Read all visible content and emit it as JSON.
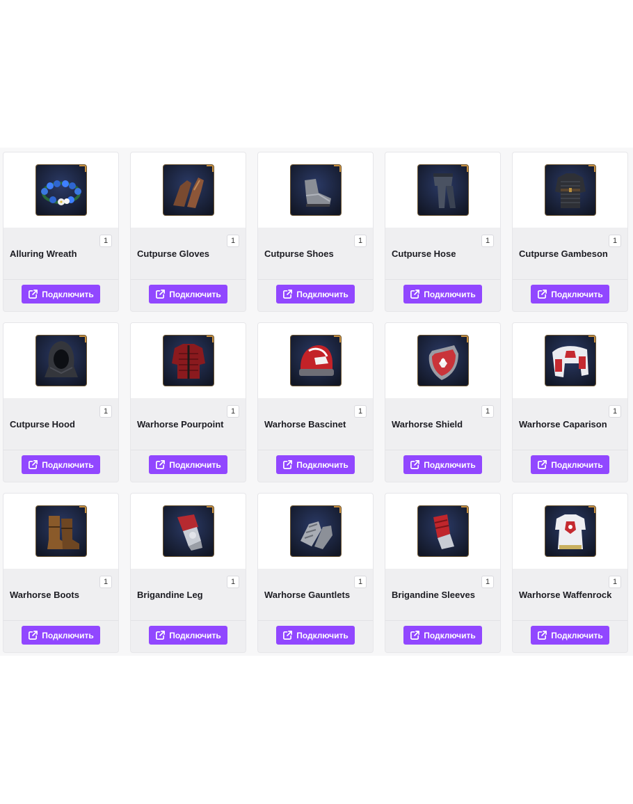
{
  "button_label": "Подключить",
  "accent_color": "#9147ff",
  "items": [
    {
      "name": "Alluring Wreath",
      "count": "1",
      "icon": "flower-wreath-icon"
    },
    {
      "name": "Cutpurse Gloves",
      "count": "1",
      "icon": "gloves-icon"
    },
    {
      "name": "Cutpurse Shoes",
      "count": "1",
      "icon": "shoes-icon"
    },
    {
      "name": "Cutpurse Hose",
      "count": "1",
      "icon": "hose-icon"
    },
    {
      "name": "Cutpurse Gambeson",
      "count": "1",
      "icon": "gambeson-icon"
    },
    {
      "name": "Cutpurse Hood",
      "count": "1",
      "icon": "hood-icon"
    },
    {
      "name": "Warhorse Pourpoint",
      "count": "1",
      "icon": "pourpoint-icon"
    },
    {
      "name": "Warhorse Bascinet",
      "count": "1",
      "icon": "helmet-icon"
    },
    {
      "name": "Warhorse Shield",
      "count": "1",
      "icon": "shield-icon"
    },
    {
      "name": "Warhorse Caparison",
      "count": "1",
      "icon": "caparison-icon"
    },
    {
      "name": "Warhorse Boots",
      "count": "1",
      "icon": "boots-icon"
    },
    {
      "name": "Brigandine Leg",
      "count": "1",
      "icon": "leg-armor-icon"
    },
    {
      "name": "Warhorse Gauntlets",
      "count": "1",
      "icon": "gauntlets-icon"
    },
    {
      "name": "Brigandine Sleeves",
      "count": "1",
      "icon": "sleeves-icon"
    },
    {
      "name": "Warhorse Waffenrock",
      "count": "1",
      "icon": "waffenrock-icon"
    }
  ]
}
